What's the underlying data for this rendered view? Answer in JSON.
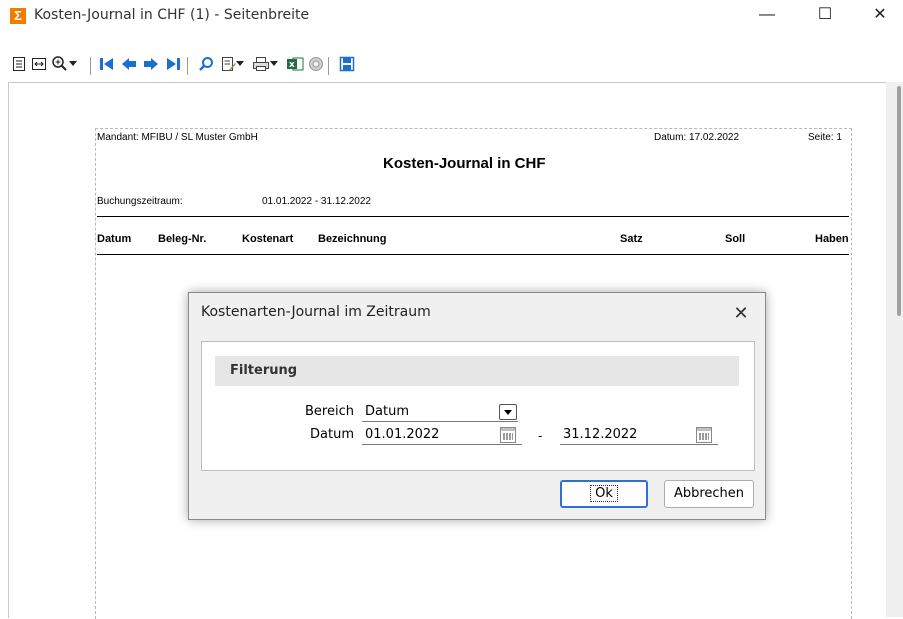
{
  "window": {
    "title": "Kosten-Journal in CHF (1) - Seitenbreite",
    "app_icon_glyph": "Σ",
    "minimize": "—",
    "maximize": "☐",
    "close": "✕"
  },
  "toolbar": {
    "icons": [
      "single-page-icon",
      "page-width-icon",
      "zoom-icon",
      "first-page-icon",
      "previous-page-icon",
      "next-page-icon",
      "last-page-icon",
      "search-icon",
      "export-icon",
      "print-icon",
      "excel-icon",
      "settings-icon",
      "save-icon"
    ]
  },
  "report": {
    "mandant": "Mandant: MFIBU / SL Muster GmbH",
    "datum": "Datum:  17.02.2022",
    "seite": "Seite: 1",
    "title": "Kosten-Journal in CHF",
    "zeitraum_label": "Buchungszeitraum:",
    "zeitraum_value": "01.01.2022 - 31.12.2022",
    "columns": [
      "Datum",
      "Beleg-Nr.",
      "Kostenart",
      "Bezeichnung",
      "Satz",
      "Soll",
      "Haben"
    ]
  },
  "dialog": {
    "title": "Kostenarten-Journal im Zeitraum",
    "close": "✕",
    "group_label": "Filterung",
    "bereich_label": "Bereich",
    "bereich_value": "Datum",
    "datum_label": "Datum",
    "date_from": "01.01.2022",
    "date_separator": "-",
    "date_to": "31.12.2022",
    "ok_label": "Ok",
    "cancel_label": "Abbrechen"
  },
  "colors": {
    "app_icon": "#f07d00",
    "ok_border": "#2f6fd6",
    "group_header": "#e6e6e6",
    "dialog_bg": "#f0f0f0"
  }
}
